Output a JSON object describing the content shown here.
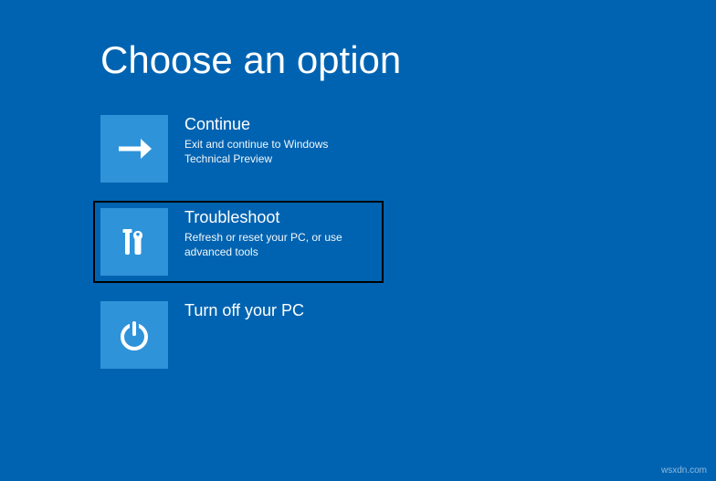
{
  "page": {
    "title": "Choose an option"
  },
  "options": [
    {
      "icon": "arrow-right-icon",
      "title": "Continue",
      "description": "Exit and continue to Windows Technical Preview"
    },
    {
      "icon": "tools-icon",
      "title": "Troubleshoot",
      "description": "Refresh or reset your PC, or use advanced tools"
    },
    {
      "icon": "power-icon",
      "title": "Turn off your PC",
      "description": ""
    }
  ],
  "watermark": "wsxdn.com"
}
